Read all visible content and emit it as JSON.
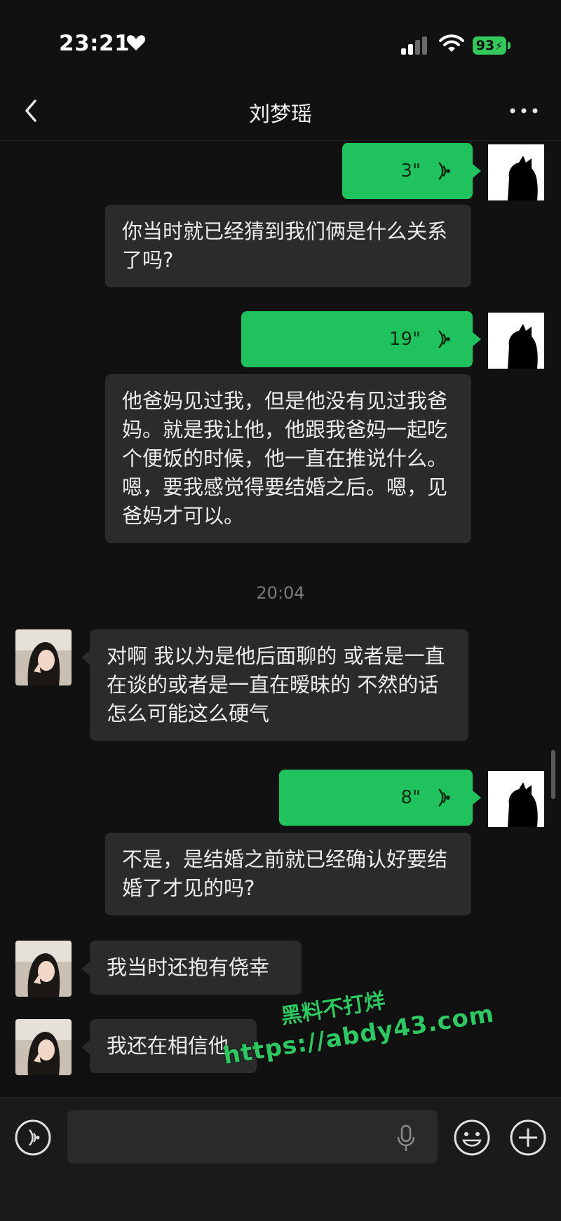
{
  "status_bar": {
    "time": "23:21",
    "battery": "93"
  },
  "header": {
    "title": "刘梦瑶"
  },
  "messages": [
    {
      "from": "me",
      "type": "voice",
      "duration": "3\""
    },
    {
      "from": "me",
      "type": "text",
      "text": "你当时就已经猜到我们俩是什么关系了吗?"
    },
    {
      "from": "me",
      "type": "voice",
      "duration": "19\""
    },
    {
      "from": "me",
      "type": "text",
      "text": "他爸妈见过我，但是他没有见过我爸妈。就是我让他，他跟我爸妈一起吃个便饭的时候，他一直在推说什么。嗯，要我感觉得要结婚之后。嗯，见爸妈才可以。"
    },
    {
      "type": "timestamp",
      "text": "20:04"
    },
    {
      "from": "her",
      "type": "text",
      "text": "对啊 我以为是他后面聊的 或者是一直在谈的或者是一直在暧昧的 不然的话怎么可能这么硬气"
    },
    {
      "from": "me",
      "type": "voice",
      "duration": "8\""
    },
    {
      "from": "me",
      "type": "text",
      "text": "不是，是结婚之前就已经确认好要结婚了才见的吗?"
    },
    {
      "from": "her",
      "type": "text",
      "text": "我当时还抱有侥幸"
    },
    {
      "from": "her",
      "type": "text",
      "text": "我还在相信他"
    }
  ],
  "watermark": {
    "line1": "黑料不打烊",
    "line2": "https://abdy43.com"
  },
  "input_bar": {
    "placeholder": ""
  },
  "colors": {
    "background": "#111111",
    "my_bubble": "#1fc25c",
    "other_bubble": "#2b2b2b",
    "battery": "#34c759"
  }
}
